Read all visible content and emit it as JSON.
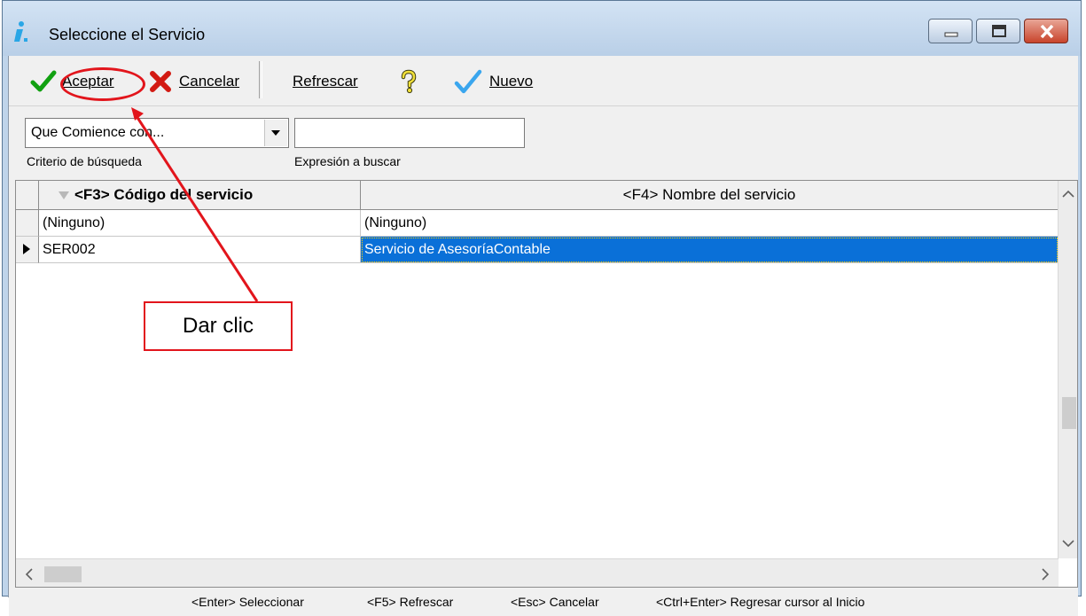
{
  "window": {
    "title": "Seleccione el Servicio",
    "controls": [
      "minimize-icon",
      "maximize-icon",
      "close-icon"
    ]
  },
  "toolbar": {
    "accept_label": "Aceptar",
    "cancel_label": "Cancelar",
    "refresh_label": "Refrescar",
    "new_label": "Nuevo",
    "icons": [
      "check-icon",
      "x-icon",
      "help-icon",
      "checkmark-icon"
    ]
  },
  "search": {
    "criteria_value": "Que Comience con...",
    "criteria_caption": "Criterio de búsqueda",
    "expression_value": "",
    "expression_caption": "Expresión a buscar"
  },
  "grid": {
    "columns": [
      "<F3> Código del servicio",
      "<F4> Nombre del servicio"
    ],
    "rows": [
      {
        "code": "(Ninguno)",
        "name": "(Ninguno)"
      },
      {
        "code": "SER002",
        "name": "Servicio de AsesoríaContable"
      }
    ],
    "selected_row": 1
  },
  "statusbar": {
    "items": [
      "<Enter> Seleccionar",
      "<F5> Refrescar",
      "<Esc> Cancelar",
      "<Ctrl+Enter> Regresar cursor al Inicio"
    ]
  },
  "annotation": {
    "callout_text": "Dar clic",
    "accent_color": "#e2151c"
  }
}
